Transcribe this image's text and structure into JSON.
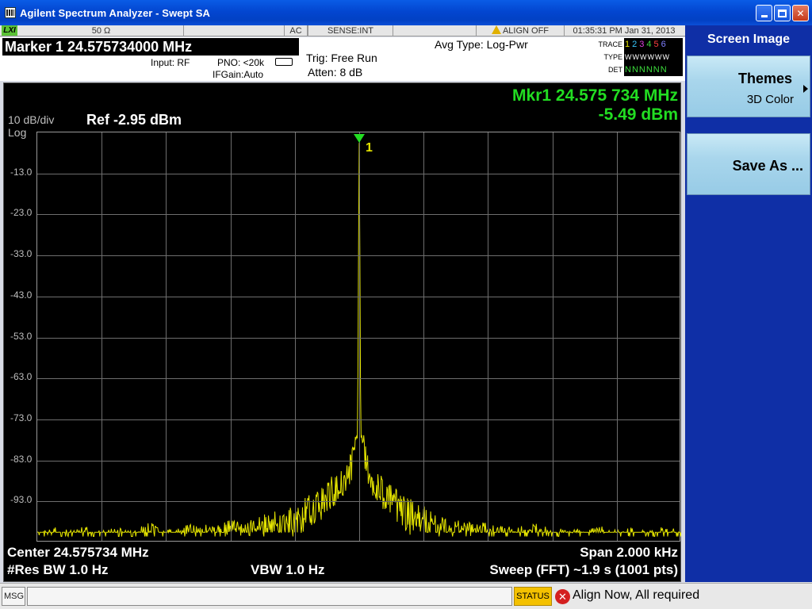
{
  "window": {
    "title": "Agilent Spectrum Analyzer - Swept SA"
  },
  "status_strip": {
    "lxi": "LXI",
    "impedance": "50 Ω",
    "coupling": "AC",
    "sense": "SENSE:INT",
    "align": "ALIGN OFF",
    "datetime": "01:35:31 PM Jan 31, 2013"
  },
  "header": {
    "marker": "Marker 1  24.575734000 MHz",
    "input": "Input: RF",
    "pno": "PNO: <20k",
    "ifgain": "IFGain:Auto",
    "trig": "Trig: Free Run",
    "atten": "Atten: 8 dB",
    "avg_type": "Avg Type: Log-Pwr",
    "trace_label": "TRACE",
    "type_label": "TYPE",
    "det_label": "DET",
    "trace_digits": [
      "1",
      "2",
      "3",
      "4",
      "5",
      "6"
    ],
    "trace_colors": [
      "#e5e500",
      "#38c8ff",
      "#e040e0",
      "#3cdc3c",
      "#ff4040",
      "#8080ff"
    ],
    "type_values": "WWWWWW",
    "det_values": "NNNNNN"
  },
  "display": {
    "scale": "10 dB/div",
    "scale_type": "Log",
    "ref": "Ref -2.95 dBm",
    "mkr_freq": "Mkr1 24.575 734 MHz",
    "mkr_amp": "-5.49 dBm",
    "marker_number": "1",
    "center": "Center 24.575734 MHz",
    "span": "Span 2.000 kHz",
    "res_bw": "#Res BW 1.0 Hz",
    "vbw": "VBW 1.0 Hz",
    "sweep": "Sweep (FFT)  ~1.9 s (1001 pts)"
  },
  "chart_data": {
    "type": "line",
    "y_tick_labels": [
      "-13.0",
      "-23.0",
      "-33.0",
      "-43.0",
      "-53.0",
      "-63.0",
      "-73.0",
      "-83.0",
      "-93.0"
    ],
    "ylim": [
      -102.95,
      -2.95
    ],
    "x_units": "kHz offset from center",
    "xlim": [
      -1.0,
      1.0
    ],
    "trace_color": "#e5e500",
    "noise_floor_dbm": -100,
    "series": [
      {
        "values": [
          [
            -1.0,
            -100
          ],
          [
            -0.95,
            -99
          ],
          [
            -0.9,
            -100
          ],
          [
            -0.85,
            -99
          ],
          [
            -0.8,
            -100
          ],
          [
            -0.75,
            -99
          ],
          [
            -0.7,
            -100
          ],
          [
            -0.65,
            -98
          ],
          [
            -0.6,
            -100
          ],
          [
            -0.55,
            -99
          ],
          [
            -0.5,
            -98
          ],
          [
            -0.45,
            -99
          ],
          [
            -0.4,
            -97
          ],
          [
            -0.35,
            -98
          ],
          [
            -0.3,
            -96
          ],
          [
            -0.25,
            -95
          ],
          [
            -0.2,
            -94
          ],
          [
            -0.15,
            -91
          ],
          [
            -0.1,
            -88
          ],
          [
            -0.05,
            -84
          ],
          [
            -0.03,
            -82
          ],
          [
            -0.015,
            -77
          ],
          [
            -0.005,
            -69
          ],
          [
            0.0,
            -5.49
          ],
          [
            0.005,
            -69
          ],
          [
            0.015,
            -77
          ],
          [
            0.03,
            -82
          ],
          [
            0.05,
            -85
          ],
          [
            0.1,
            -89
          ],
          [
            0.15,
            -92
          ],
          [
            0.2,
            -94
          ],
          [
            0.25,
            -96
          ],
          [
            0.3,
            -97
          ],
          [
            0.35,
            -98
          ],
          [
            0.4,
            -98
          ],
          [
            0.45,
            -99
          ],
          [
            0.5,
            -99
          ],
          [
            0.55,
            -98
          ],
          [
            0.6,
            -100
          ],
          [
            0.65,
            -99
          ],
          [
            0.7,
            -100
          ],
          [
            0.75,
            -99
          ],
          [
            0.8,
            -100
          ],
          [
            0.85,
            -99
          ],
          [
            0.9,
            -100
          ],
          [
            0.95,
            -99
          ],
          [
            1.0,
            -100
          ]
        ]
      }
    ],
    "grid": true
  },
  "softkeys": {
    "title": "Screen Image",
    "themes_label": "Themes",
    "themes_value": "3D Color",
    "save_as": "Save As ..."
  },
  "msgbar": {
    "msg_label": "MSG",
    "status_button": "STATUS",
    "status_text": "Align Now, All required"
  }
}
